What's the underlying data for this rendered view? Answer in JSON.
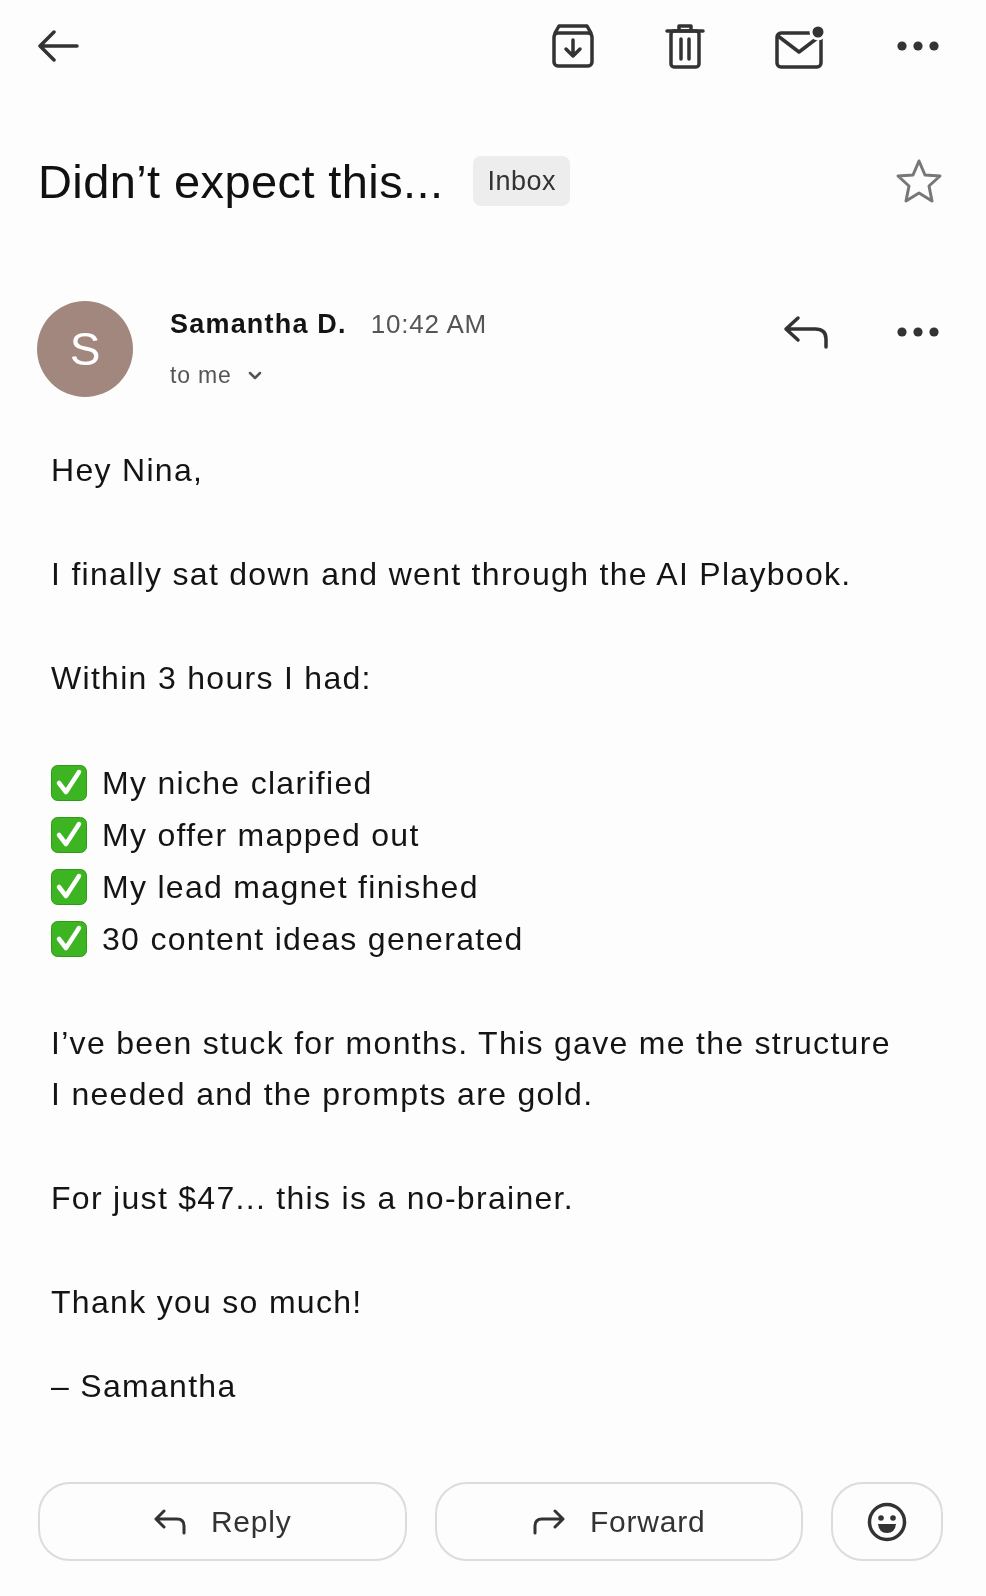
{
  "subject": {
    "title": "Didn’t expect this...",
    "label": "Inbox",
    "starred": false
  },
  "message": {
    "avatar_letter": "S",
    "sender": "Samantha D.",
    "time": "10:42 AM",
    "recipients": "to me"
  },
  "body": [
    {
      "kind": "paragraph",
      "text": "Hey Nina,"
    },
    {
      "kind": "paragraph",
      "text": "I finally sat down and went through the AI Playbook."
    },
    {
      "kind": "paragraph",
      "text": "Within 3 hours I had:"
    },
    {
      "kind": "checklist",
      "items": [
        "My niche clarified",
        "My offer mapped out",
        "My lead magnet finished",
        "30 content ideas generated"
      ]
    },
    {
      "kind": "paragraph",
      "text": "I’ve been stuck for months. This gave me the structure I needed and the prompts are gold."
    },
    {
      "kind": "paragraph",
      "text": "For just $47... this is a no-brainer."
    },
    {
      "kind": "paragraph",
      "text": "Thank you so much!"
    },
    {
      "kind": "signature",
      "text": "– Samantha"
    }
  ],
  "actions": [
    {
      "kind": "reply",
      "label": "Reply"
    },
    {
      "kind": "forward",
      "label": "Forward"
    },
    {
      "kind": "react"
    }
  ]
}
